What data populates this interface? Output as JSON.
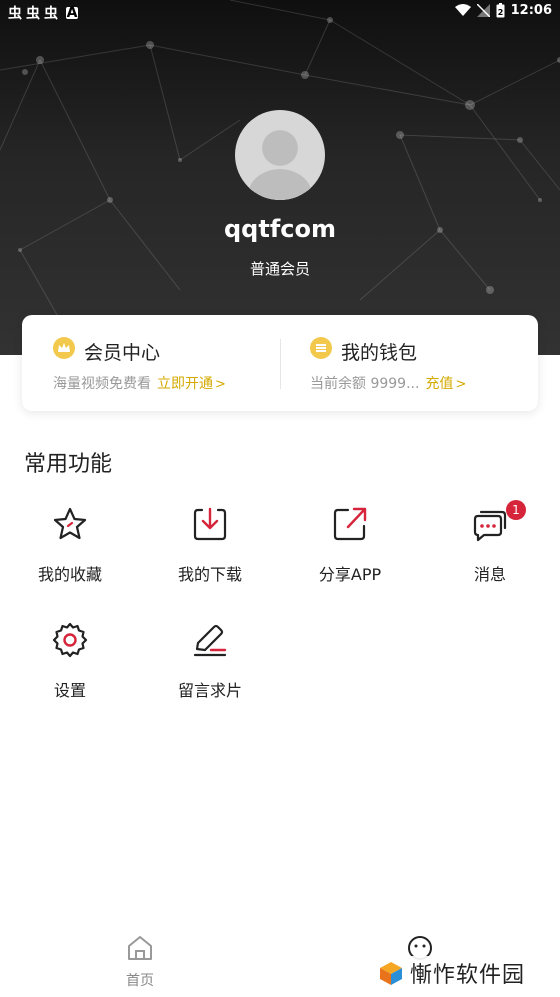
{
  "status_bar": {
    "left_icons": [
      "虫",
      "虫",
      "虫"
    ],
    "letter": "A",
    "time": "12:06",
    "battery_level": "2"
  },
  "profile": {
    "username": "qqtfcom",
    "member_level": "普通会员"
  },
  "member_card": {
    "vip": {
      "title": "会员中心",
      "subtitle": "海量视频免费看",
      "link": "立即开通",
      "chevron": ">"
    },
    "wallet": {
      "title": "我的钱包",
      "subtitle": "当前余额 9999...",
      "link": "充值",
      "chevron": ">"
    }
  },
  "features": {
    "title": "常用功能",
    "items": [
      {
        "label": "我的收藏",
        "icon": "star-icon"
      },
      {
        "label": "我的下载",
        "icon": "download-icon"
      },
      {
        "label": "分享APP",
        "icon": "share-icon"
      },
      {
        "label": "消息",
        "icon": "message-icon",
        "badge": "1"
      },
      {
        "label": "设置",
        "icon": "gear-icon"
      },
      {
        "label": "留言求片",
        "icon": "edit-icon"
      }
    ]
  },
  "bottom_nav": {
    "home_label": "首页"
  },
  "watermark": {
    "text": "慚怍软件园"
  },
  "colors": {
    "accent_gold": "#d4a900",
    "coin": "#f2c94c",
    "icon_red": "#d6243a",
    "header_dark": "#1e1e1e"
  }
}
